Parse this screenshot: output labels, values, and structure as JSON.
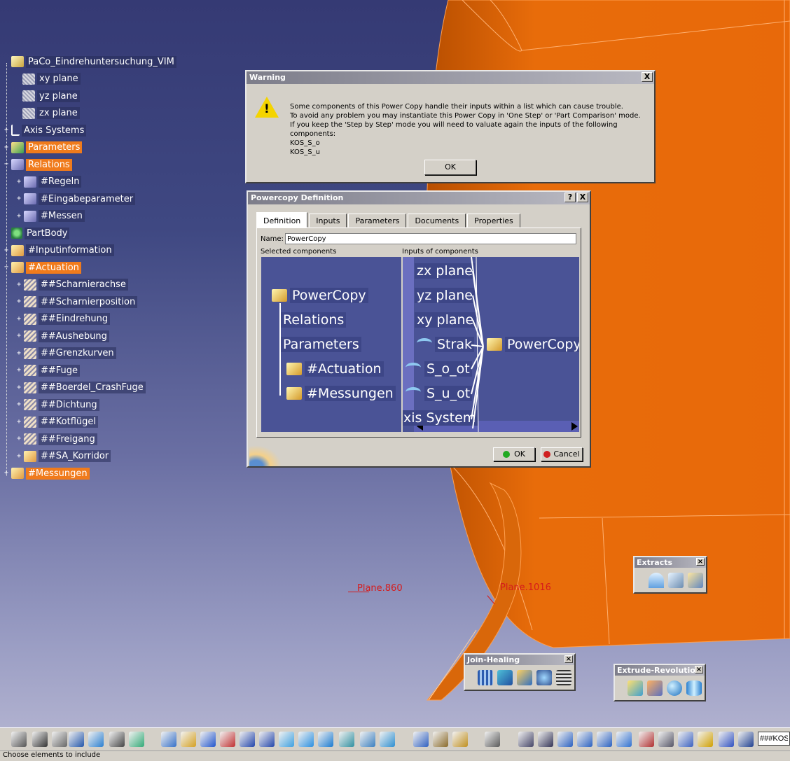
{
  "tree": {
    "items": [
      {
        "label": "PaCo_Eindrehuntersuchung_VIM",
        "highlight": false
      },
      {
        "label": "xy plane",
        "highlight": false
      },
      {
        "label": "yz plane",
        "highlight": false
      },
      {
        "label": "zx plane",
        "highlight": false
      },
      {
        "label": "Axis Systems",
        "highlight": false
      },
      {
        "label": "Parameters",
        "highlight": true
      },
      {
        "label": "Relations",
        "highlight": true
      },
      {
        "label": "#Regeln",
        "highlight": false
      },
      {
        "label": "#Eingabeparameter",
        "highlight": false
      },
      {
        "label": "#Messen",
        "highlight": false
      },
      {
        "label": "PartBody",
        "highlight": false
      },
      {
        "label": "#Inputinformation",
        "highlight": false
      },
      {
        "label": "#Actuation",
        "highlight": true
      },
      {
        "label": "##Scharnierachse",
        "highlight": false
      },
      {
        "label": "##Scharnierposition",
        "highlight": false
      },
      {
        "label": "##Eindrehung",
        "highlight": false
      },
      {
        "label": "##Aushebung",
        "highlight": false
      },
      {
        "label": "##Grenzkurven",
        "highlight": false
      },
      {
        "label": "##Fuge",
        "highlight": false
      },
      {
        "label": "##Boerdel_CrashFuge",
        "highlight": false
      },
      {
        "label": "##Dichtung",
        "highlight": false
      },
      {
        "label": "##Kotflügel",
        "highlight": false
      },
      {
        "label": "##Freigang",
        "highlight": false
      },
      {
        "label": "##SA_Korridor",
        "highlight": false
      },
      {
        "label": "#Messungen",
        "highlight": true
      }
    ]
  },
  "warning": {
    "title": "Warning",
    "lines": [
      "Some components of this Power Copy handle their inputs within a list which can cause trouble.",
      "To avoid any problem you may instantiate this Power Copy in 'One Step' or 'Part Comparison' mode.",
      "If you keep the 'Step by Step' mode you will need to valuate again the inputs of the following components:",
      "KOS_S_o",
      "KOS_S_u"
    ],
    "ok_label": "OK",
    "close_label": "X"
  },
  "powercopy": {
    "title": "Powercopy Definition",
    "help_label": "?",
    "close_label": "X",
    "tabs": [
      "Definition",
      "Inputs",
      "Parameters",
      "Documents",
      "Properties"
    ],
    "name_label": "Name:",
    "name_value": "PowerCopy",
    "selected_label": "Selected components",
    "inputs_label": "Inputs of components",
    "selected_tree": {
      "root": "PowerCopy",
      "children": [
        "Relations",
        "Parameters",
        "#Actuation",
        "#Messungen"
      ]
    },
    "inputs": [
      "zx plane",
      "yz plane",
      "xy plane",
      "Strak",
      "S_o_ot",
      "S_u_ot",
      "xis System"
    ],
    "result_node": "PowerCopy",
    "ok_label": "OK",
    "cancel_label": "Cancel"
  },
  "toolbars": {
    "extracts": "Extracts",
    "join_healing": "Join-Healing",
    "extrude_revolution": "Extrude-Revolution"
  },
  "viewport_labels": {
    "plane1": "Plane.860",
    "plane2": "Plane.1016"
  },
  "command_input": "###KOS",
  "status_text": "Choose elements to include"
}
